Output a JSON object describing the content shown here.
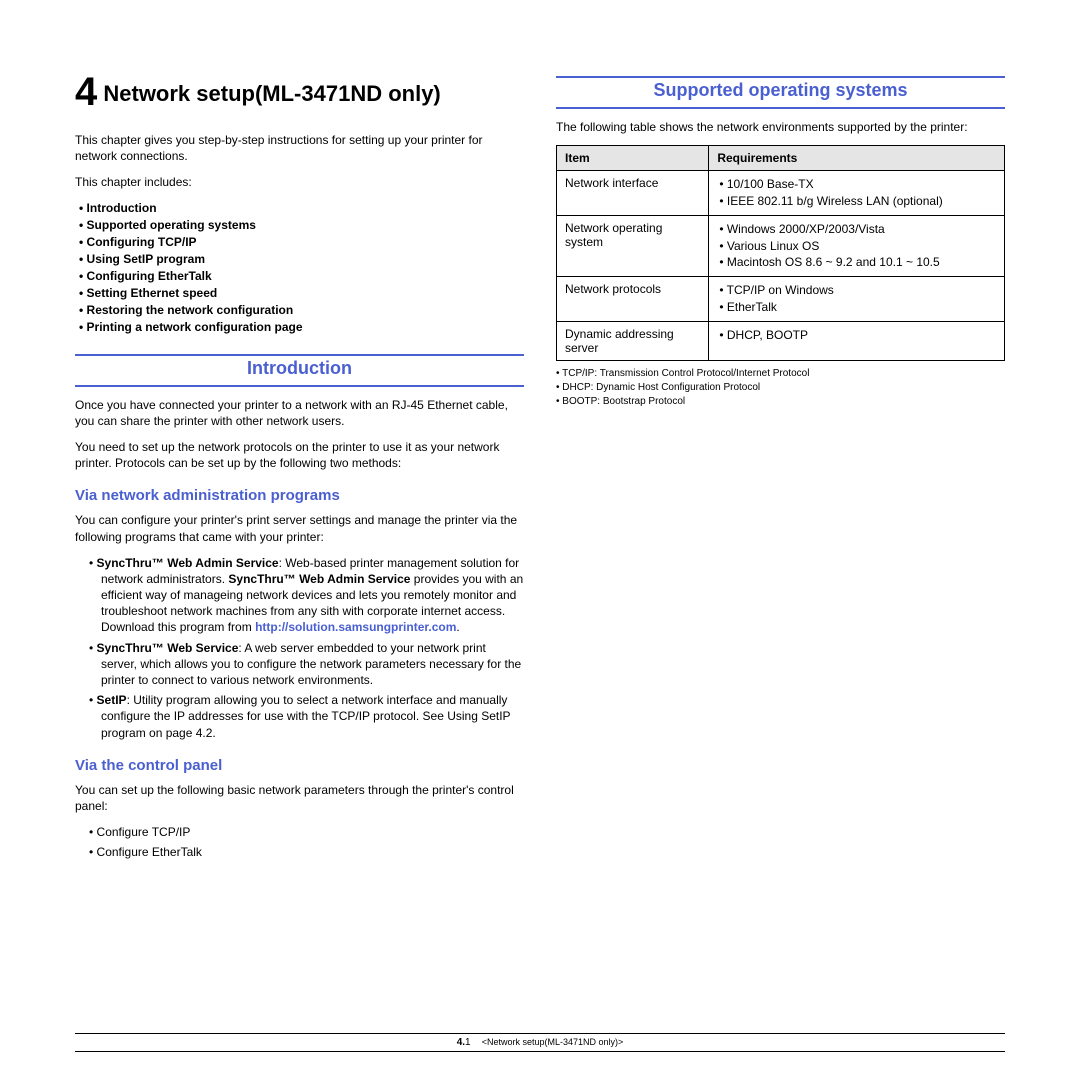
{
  "chapter": {
    "number": "4",
    "title": "Network setup(ML-3471ND only)"
  },
  "intro_para": "This chapter gives you step-by-step instructions for setting up your printer for network connections.",
  "includes_label": "This chapter includes:",
  "toc": [
    "Introduction",
    "Supported operating systems",
    "Configuring TCP/IP",
    "Using SetIP program",
    "Configuring EtherTalk",
    "Setting Ethernet speed",
    "Restoring the network configuration",
    "Printing a network configuration page"
  ],
  "sections": {
    "introduction": {
      "title": "Introduction",
      "p1": "Once you have connected your printer to a network with an RJ-45 Ethernet cable, you can share the printer with other network users.",
      "p2": "You need to set up the network protocols on the printer to use it as your network printer. Protocols can be set up by the following two methods:",
      "sub_admin": {
        "title": "Via network administration programs",
        "lead": "You can configure your printer's print server settings and manage the printer via the following programs that came with your printer:",
        "sync_admin_b1": "SyncThru™ Web Admin Service",
        "sync_admin_t1": ": Web-based printer management solution for network administrators. ",
        "sync_admin_b2": "SyncThru™ Web Admin Service",
        "sync_admin_t2": " provides you with an efficient way of manageing network devices and lets you remotely monitor and troubleshoot network machines from any sith with corporate internet access. Download this program from ",
        "sync_admin_link": "http://solution.samsungprinter.com",
        "sync_admin_t3": ".",
        "sync_web_b": "SyncThru™ Web Service",
        "sync_web_t": ": A web server embedded to your network print server, which allows you to configure the network parameters necessary for the printer to connect to various network environments.",
        "setip_b": "SetIP",
        "setip_t": ": Utility program allowing you to select a network interface and manually configure the IP addresses for use with the TCP/IP protocol. See Using SetIP program on page 4.2."
      },
      "sub_panel": {
        "title": "Via the control panel",
        "lead": "You can set up the following basic network parameters through the printer's control panel:",
        "items": [
          "Configure TCP/IP",
          "Configure EtherTalk"
        ]
      }
    },
    "supported": {
      "title": "Supported operating systems",
      "lead": "The following table shows the network environments supported by the printer:",
      "th_item": "Item",
      "th_req": "Requirements",
      "rows": [
        {
          "item": "Network interface",
          "reqs": [
            "10/100 Base-TX",
            "IEEE 802.11 b/g Wireless LAN (optional)"
          ]
        },
        {
          "item": "Network operating system",
          "reqs": [
            "Windows 2000/XP/2003/Vista",
            "Various Linux OS",
            "Macintosh OS 8.6 ~ 9.2 and 10.1 ~ 10.5"
          ]
        },
        {
          "item": "Network protocols",
          "reqs": [
            "TCP/IP on Windows",
            "EtherTalk"
          ]
        },
        {
          "item": "Dynamic addressing server",
          "reqs": [
            "DHCP, BOOTP"
          ]
        }
      ],
      "footnotes": [
        "TCP/IP: Transmission Control Protocol/Internet Protocol",
        "DHCP: Dynamic Host Configuration Protocol",
        "BOOTP: Bootstrap Protocol"
      ]
    }
  },
  "footer": {
    "page_bold": "4.",
    "page_num": "1",
    "chapter_ref": "<Network setup(ML-3471ND only)>"
  }
}
